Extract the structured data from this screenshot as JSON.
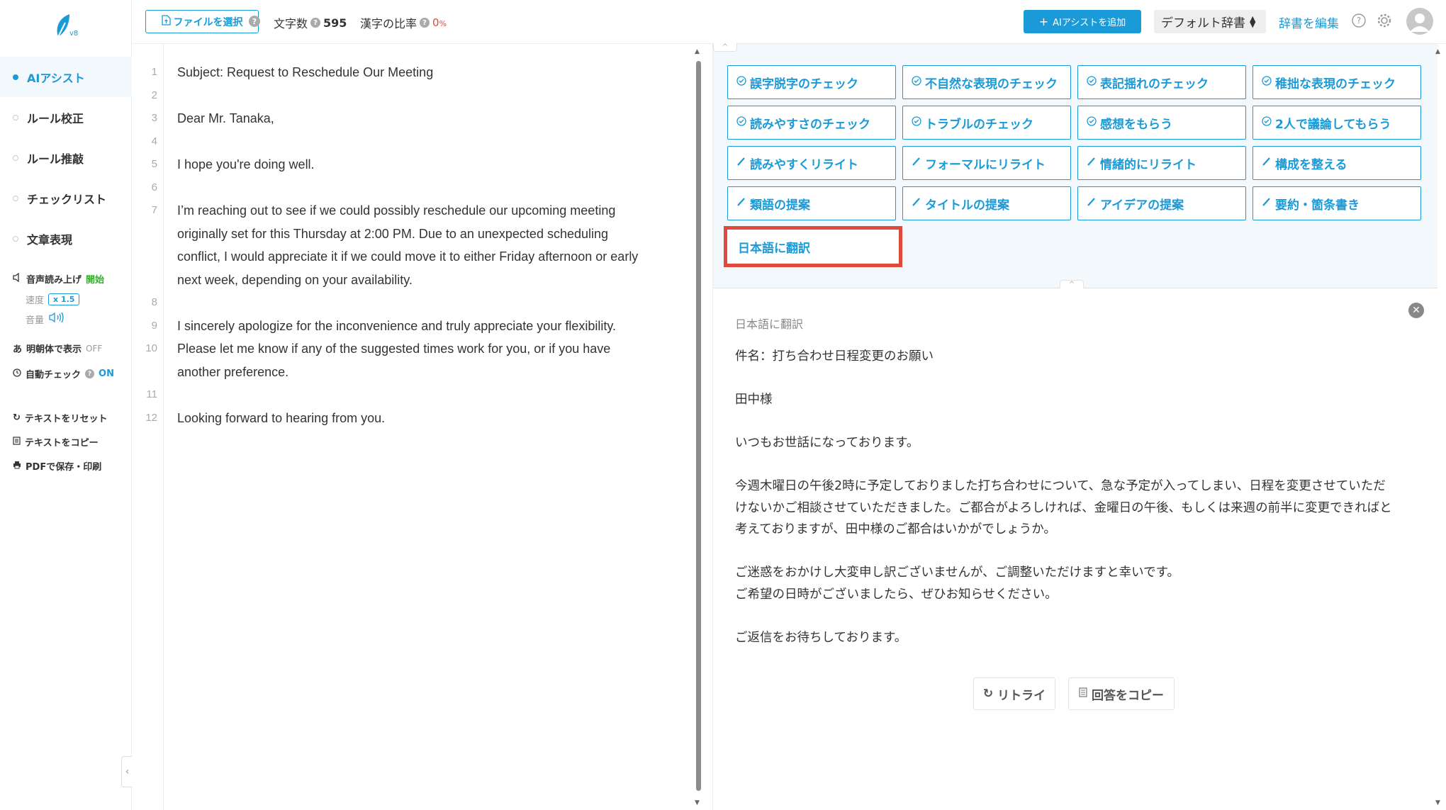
{
  "sidebar": {
    "logo_version": "v8",
    "nav": [
      {
        "label": "AIアシスト",
        "active": true
      },
      {
        "label": "ルール校正",
        "active": false
      },
      {
        "label": "ルール推敲",
        "active": false
      },
      {
        "label": "チェックリスト",
        "active": false
      },
      {
        "label": "文章表現",
        "active": false
      }
    ],
    "voice": {
      "label": "音声読み上げ",
      "start": "開始",
      "speed_label": "速度",
      "speed_value": "x 1.5",
      "volume_label": "音量"
    },
    "mincho": {
      "label": "明朝体で表示",
      "state": "OFF"
    },
    "auto_check": {
      "label": "自動チェック",
      "state": "ON"
    },
    "actions": {
      "reset": "テキストをリセット",
      "copy": "テキストをコピー",
      "pdf": "PDFで保存・印刷"
    }
  },
  "topbar": {
    "file_button": "ファイルを選択",
    "char_count_label": "文字数",
    "char_count": "595",
    "kanji_label": "漢字の比率",
    "kanji_value": "0",
    "kanji_unit": "%",
    "add_ai": "AIアシストを追加",
    "dict_select": "デフォルト辞書",
    "dict_edit": "辞書を編集"
  },
  "editor": {
    "lines": [
      {
        "num": "1",
        "text": "Subject: Request to Reschedule Our Meeting"
      },
      {
        "num": "2",
        "text": ""
      },
      {
        "num": "3",
        "text": "Dear Mr. Tanaka,"
      },
      {
        "num": "4",
        "text": ""
      },
      {
        "num": "5",
        "text": "I hope you're doing well."
      },
      {
        "num": "6",
        "text": ""
      },
      {
        "num": "7",
        "text": "I’m reaching out to see if we could possibly reschedule our upcoming meeting"
      },
      {
        "num": "",
        "text": "originally set for this Thursday at 2:00 PM. Due to an unexpected scheduling"
      },
      {
        "num": "",
        "text": "conflict, I would appreciate it if we could move it to either Friday afternoon or early"
      },
      {
        "num": "",
        "text": "next week, depending on your availability."
      },
      {
        "num": "8",
        "text": ""
      },
      {
        "num": "9",
        "text": "I sincerely apologize for the inconvenience and truly appreciate your flexibility."
      },
      {
        "num": "10",
        "text": "Please let me know if any of the suggested times work for you, or if you have"
      },
      {
        "num": "",
        "text": "another preference."
      },
      {
        "num": "11",
        "text": ""
      },
      {
        "num": "12",
        "text": "Looking forward to hearing from you."
      }
    ]
  },
  "assist_buttons": [
    {
      "icon": "check",
      "label": "誤字脱字のチェック"
    },
    {
      "icon": "check",
      "label": "不自然な表現のチェック"
    },
    {
      "icon": "check",
      "label": "表記揺れのチェック"
    },
    {
      "icon": "check",
      "label": "稚拙な表現のチェック"
    },
    {
      "icon": "check",
      "label": "読みやすさのチェック"
    },
    {
      "icon": "check",
      "label": "トラブルのチェック"
    },
    {
      "icon": "check",
      "label": "感想をもらう"
    },
    {
      "icon": "check",
      "label": "2人で議論してもらう"
    },
    {
      "icon": "pen",
      "label": "読みやすくリライト"
    },
    {
      "icon": "pen",
      "label": "フォーマルにリライト"
    },
    {
      "icon": "pen",
      "label": "情緒的にリライト"
    },
    {
      "icon": "pen",
      "label": "構成を整える"
    },
    {
      "icon": "pen",
      "label": "類語の提案"
    },
    {
      "icon": "pen",
      "label": "タイトルの提案"
    },
    {
      "icon": "pen",
      "label": "アイデアの提案"
    },
    {
      "icon": "pen",
      "label": "要約・箇条書き"
    }
  ],
  "translate_button": "日本語に翻訳",
  "result": {
    "title": "日本語に翻訳",
    "lines": [
      "件名：打ち合わせ日程変更のお願い",
      "",
      "田中様",
      "",
      "いつもお世話になっております。",
      "",
      "今週木曜日の午後2時に予定しておりました打ち合わせについて、急な予定が入ってしまい、日程を変更させていただ",
      "けないかご相談させていただきました。ご都合がよろしければ、金曜日の午後、もしくは来週の前半に変更できればと",
      "考えておりますが、田中様のご都合はいかがでしょうか。",
      "",
      "ご迷惑をおかけし大変申し訳ございませんが、ご調整いただけますと幸いです。",
      "ご希望の日時がございましたら、ぜひお知らせください。",
      "",
      "ご返信をお待ちしております。"
    ],
    "retry": "リトライ",
    "copy": "回答をコピー"
  },
  "colors": {
    "accent": "#1a9ad6",
    "highlight": "#e04a3c",
    "green": "#3aaa35"
  }
}
